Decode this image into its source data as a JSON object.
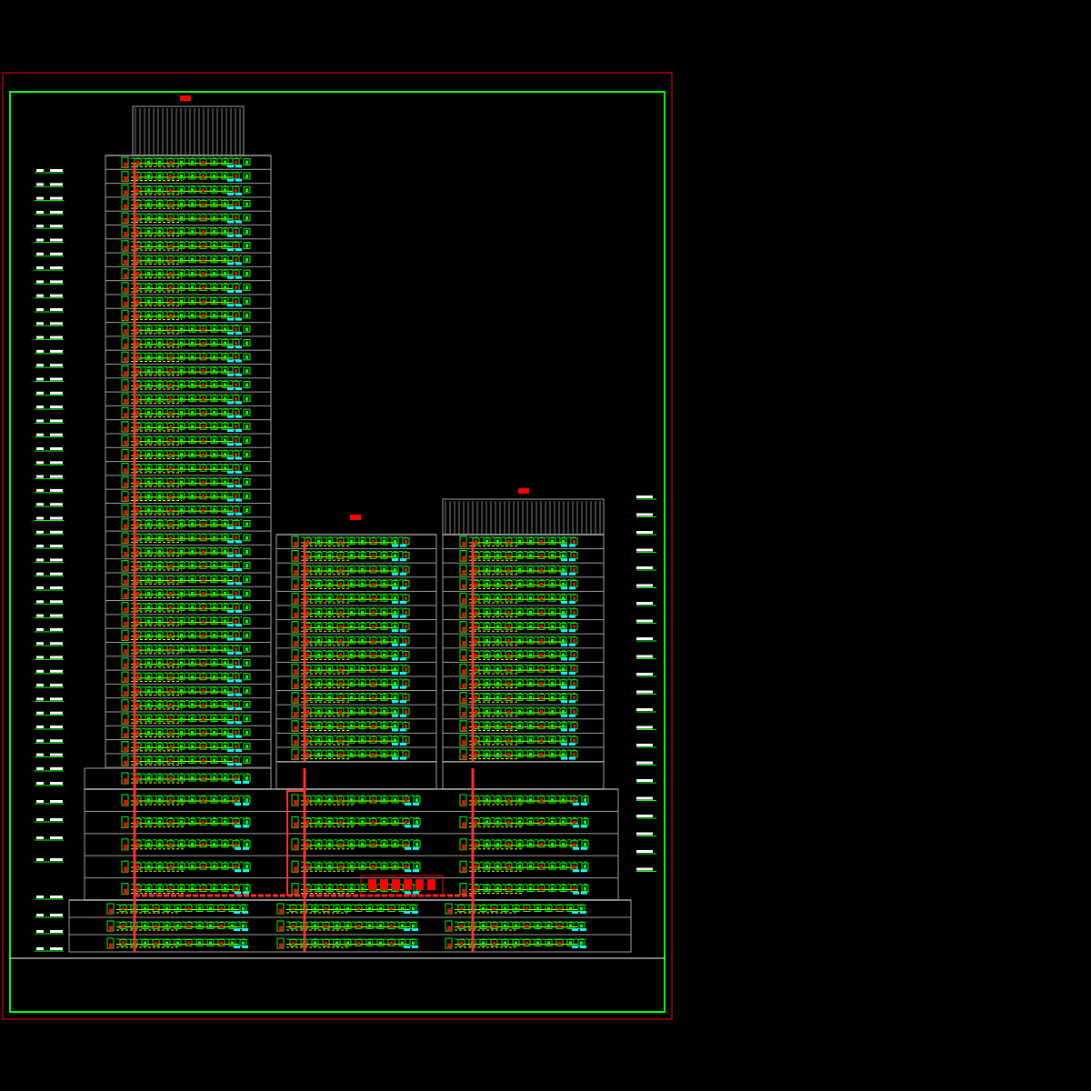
{
  "towers": [
    {
      "kind": "roofed"
    },
    {
      "kind": "plain"
    },
    {
      "kind": "roofed"
    }
  ]
}
